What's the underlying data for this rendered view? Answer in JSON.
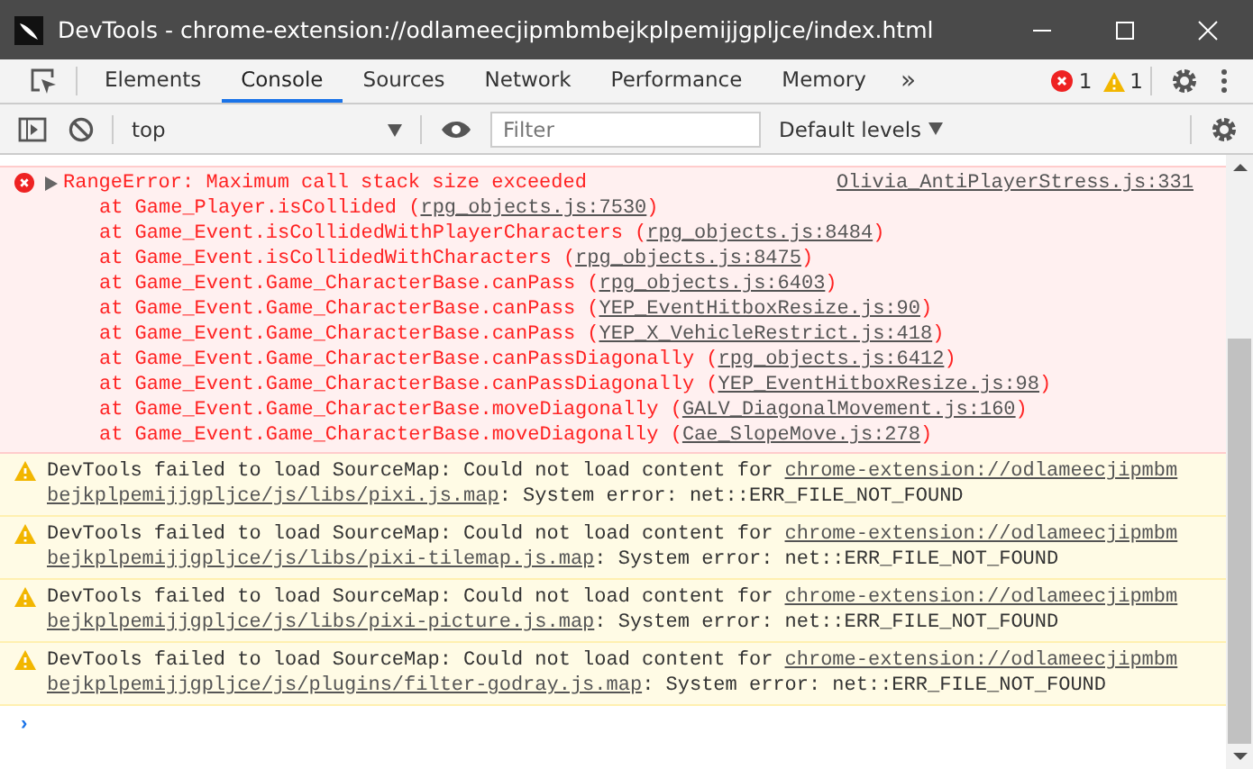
{
  "window": {
    "title": "DevTools - chrome-extension://odlameecjipmbmbejkplpemijjgpljce/index.html"
  },
  "tabs": [
    {
      "label": "Elements",
      "selected": false
    },
    {
      "label": "Console",
      "selected": true
    },
    {
      "label": "Sources",
      "selected": false
    },
    {
      "label": "Network",
      "selected": false
    },
    {
      "label": "Performance",
      "selected": false
    },
    {
      "label": "Memory",
      "selected": false
    }
  ],
  "more_tabs": "»",
  "counts": {
    "errors": "1",
    "warnings": "1"
  },
  "toolbar": {
    "context": "top",
    "filter_placeholder": "Filter",
    "levels": "Default levels"
  },
  "messages": [
    {
      "kind": "error",
      "text": "RangeError: Maximum call stack size exceeded",
      "source": "Olivia_AntiPlayerStress.js:331",
      "expanded": false,
      "frames": [
        {
          "fn": "at Game_Player.isCollided (",
          "link": "rpg_objects.js:7530",
          "end": ")"
        },
        {
          "fn": "at Game_Event.isCollidedWithPlayerCharacters (",
          "link": "rpg_objects.js:8484",
          "end": ")"
        },
        {
          "fn": "at Game_Event.isCollidedWithCharacters (",
          "link": "rpg_objects.js:8475",
          "end": ")"
        },
        {
          "fn": "at Game_Event.Game_CharacterBase.canPass (",
          "link": "rpg_objects.js:6403",
          "end": ")"
        },
        {
          "fn": "at Game_Event.Game_CharacterBase.canPass (",
          "link": "YEP_EventHitboxResize.js:90",
          "end": ")"
        },
        {
          "fn": "at Game_Event.Game_CharacterBase.canPass (",
          "link": "YEP_X_VehicleRestrict.js:418",
          "end": ")"
        },
        {
          "fn": "at Game_Event.Game_CharacterBase.canPassDiagonally (",
          "link": "rpg_objects.js:6412",
          "end": ")"
        },
        {
          "fn": "at Game_Event.Game_CharacterBase.canPassDiagonally (",
          "link": "YEP_EventHitboxResize.js:98",
          "end": ")"
        },
        {
          "fn": "at Game_Event.Game_CharacterBase.moveDiagonally (",
          "link": "GALV_DiagonalMovement.js:160",
          "end": ")"
        },
        {
          "fn": "at Game_Event.Game_CharacterBase.moveDiagonally (",
          "link": "Cae_SlopeMove.js:278",
          "end": ")"
        }
      ]
    },
    {
      "kind": "warning",
      "text": "DevTools failed to load SourceMap: Could not load content for",
      "link_lines": [
        "chrome-extension://odlameecjipmbm",
        "bejkplpemijjgpljce/js/libs/pixi.js.map"
      ],
      "suffix": ": System error: net::ERR_FILE_NOT_FOUND"
    },
    {
      "kind": "warning",
      "text": "DevTools failed to load SourceMap: Could not load content for",
      "link_lines": [
        "chrome-extension://odlameecjipmbm",
        "bejkplpemijjgpljce/js/libs/pixi-tilemap.js.map"
      ],
      "suffix": ": System error: net::ERR_FILE_NOT_FOUND"
    },
    {
      "kind": "warning",
      "text": "DevTools failed to load SourceMap: Could not load content for",
      "link_lines": [
        "chrome-extension://odlameecjipmbm",
        "bejkplpemijjgpljce/js/libs/pixi-picture.js.map"
      ],
      "suffix": ": System error: net::ERR_FILE_NOT_FOUND"
    },
    {
      "kind": "warning",
      "text": "DevTools failed to load SourceMap: Could not load content for",
      "link_lines": [
        "chrome-extension://odlameecjipmbm",
        "bejkplpemijjgpljce/js/plugins/filter-godray.js.map"
      ],
      "suffix": ": System error: net::ERR_FILE_NOT_FOUND"
    }
  ],
  "prompt": "›"
}
